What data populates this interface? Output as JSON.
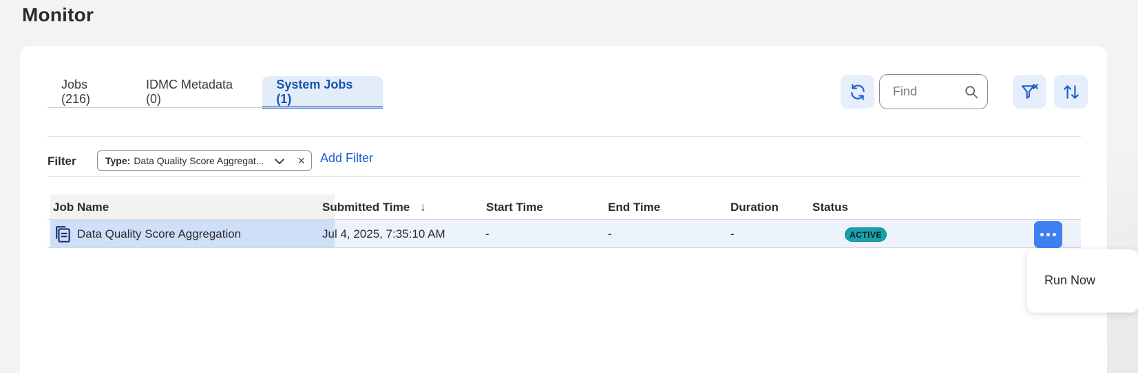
{
  "page": {
    "title": "Monitor"
  },
  "tabs": [
    {
      "label": "Jobs (216)"
    },
    {
      "label": "IDMC Metadata (0)"
    },
    {
      "label": "System Jobs (1)"
    }
  ],
  "toolbar": {
    "refresh_icon": "refresh-icon",
    "find_placeholder": "Find",
    "search_icon": "search-icon",
    "clear_filter_icon": "filter-clear-icon",
    "sort_icon": "sort-icon"
  },
  "filter": {
    "label": "Filter",
    "chip_key": "Type:",
    "chip_value": "Data Quality Score Aggregat...",
    "chip_remove": "×",
    "add_filter": "Add Filter"
  },
  "table": {
    "columns": [
      "Job Name",
      "Submitted Time",
      "Start Time",
      "End Time",
      "Duration",
      "Status"
    ],
    "sort_indicator": "↓",
    "rows": [
      {
        "job_name": "Data Quality Score Aggregation",
        "submitted_time": "Jul 4, 2025, 7:35:10 AM",
        "start_time": "-",
        "end_time": "-",
        "duration": "-",
        "status": "ACTIVE"
      }
    ]
  },
  "row_menu": {
    "items": [
      "Run Now"
    ]
  },
  "colors": {
    "accent": "#1a5fd0",
    "active_tab_bg": "#e3ecf9",
    "status_active": "#17a2a8",
    "more_button": "#3f7ff2"
  }
}
